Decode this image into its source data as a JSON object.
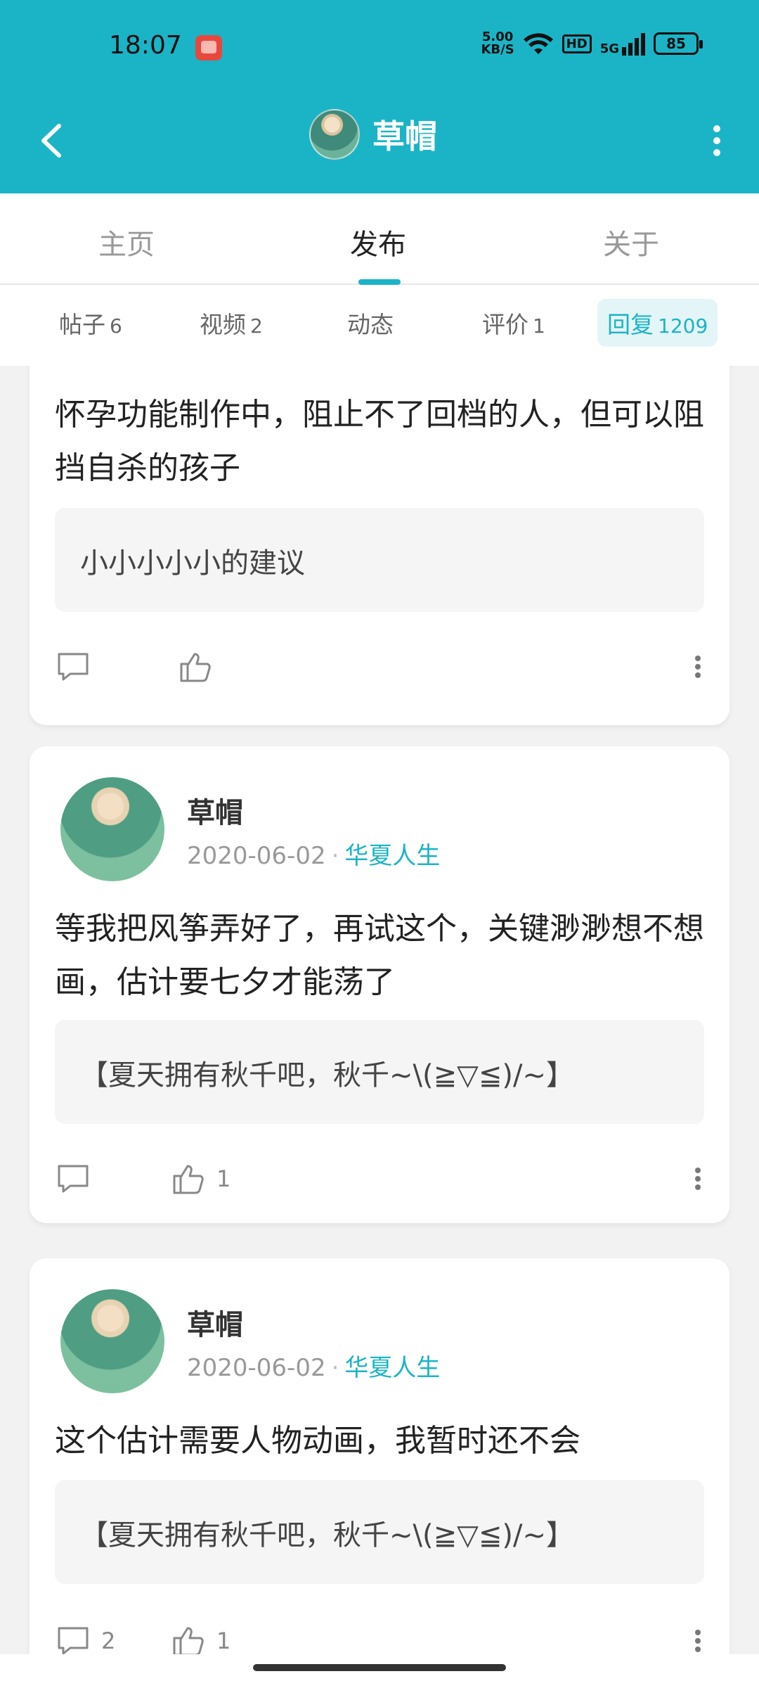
{
  "status": {
    "time": "18:07",
    "speed_top": "5.00",
    "speed_bottom": "KB/S",
    "hd": "HD",
    "network": "5G",
    "battery": "85"
  },
  "appbar": {
    "title": "草帽"
  },
  "tabs": [
    {
      "label": "主页"
    },
    {
      "label": "发布"
    },
    {
      "label": "关于"
    }
  ],
  "subtabs": [
    {
      "label": "帖子",
      "count": "6"
    },
    {
      "label": "视频",
      "count": "2"
    },
    {
      "label": "动态",
      "count": ""
    },
    {
      "label": "评价",
      "count": "1"
    },
    {
      "label": "回复",
      "count": "1209"
    }
  ],
  "posts": [
    {
      "text": "怀孕功能制作中，阻止不了回档的人，但可以阻挡自杀的孩子",
      "quote": "小小小小小的建议",
      "comment_count": "",
      "like_count": ""
    },
    {
      "author": "草帽",
      "date": "2020-06-02",
      "dot": "·",
      "topic": "华夏人生",
      "text": "等我把风筝弄好了，再试这个，关键渺渺想不想画，估计要七夕才能荡了",
      "quote": "【夏天拥有秋千吧，秋千~\\(≧▽≦)/~】",
      "comment_count": "",
      "like_count": "1"
    },
    {
      "author": "草帽",
      "date": "2020-06-02",
      "dot": "·",
      "topic": "华夏人生",
      "text": "这个估计需要人物动画，我暂时还不会",
      "quote": "【夏天拥有秋千吧，秋千~\\(≧▽≦)/~】",
      "comment_count": "2",
      "like_count": "1"
    }
  ],
  "colors": {
    "accent": "#1bb4c6",
    "background": "#f2f2f2"
  }
}
